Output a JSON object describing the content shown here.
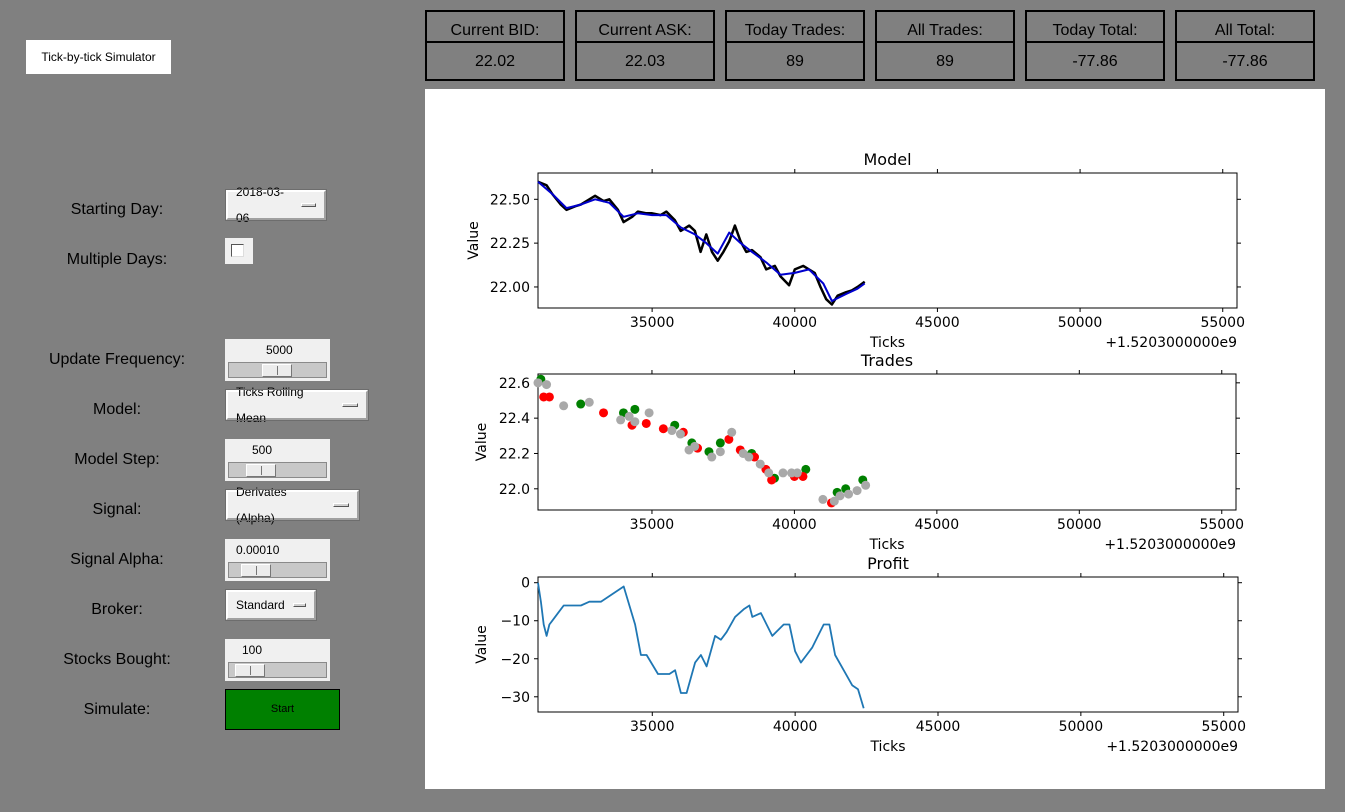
{
  "app": {
    "title": "Tick-by-tick Simulator"
  },
  "stats": [
    {
      "label": "Current BID:",
      "value": "22.02"
    },
    {
      "label": "Current ASK:",
      "value": "22.03"
    },
    {
      "label": "Today Trades:",
      "value": "89"
    },
    {
      "label": "All Trades:",
      "value": "89"
    },
    {
      "label": "Today Total:",
      "value": "-77.86"
    },
    {
      "label": "All Total:",
      "value": "-77.86"
    }
  ],
  "controls": {
    "starting_day": {
      "label": "Starting Day:",
      "value": "2018-03-06"
    },
    "multiple_days": {
      "label": "Multiple Days:",
      "checked": false
    },
    "update_frequency": {
      "label": "Update Frequency:",
      "value": "5000",
      "level": 0.42
    },
    "model": {
      "label": "Model:",
      "value": "Ticks Rolling Mean"
    },
    "model_step": {
      "label": "Model Step:",
      "value": "500",
      "level": 0.25
    },
    "signal": {
      "label": "Signal:",
      "value": "Derivates (Alpha)"
    },
    "signal_alpha": {
      "label": "Signal Alpha:",
      "value": "0.00010",
      "level": 0.2
    },
    "broker": {
      "label": "Broker:",
      "value": "Standard"
    },
    "stocks_bought": {
      "label": "Stocks Bought:",
      "value": "100",
      "level": 0.17
    },
    "simulate": {
      "label": "Simulate:",
      "button": "Start"
    }
  },
  "colors": {
    "background": "#808080",
    "start_button": "#008000",
    "price_line": "#000000",
    "model_line": "#0000cd",
    "buy": "#008000",
    "sell": "#ff0000",
    "neutral": "#a9a9a9",
    "profit_line": "#1f77b4"
  },
  "chart_data": [
    {
      "type": "line",
      "title": "Model",
      "xlabel": "Ticks",
      "ylabel": "Value",
      "offset_label": "+1.5203000000e9",
      "xlim": [
        31000,
        55500
      ],
      "ylim": [
        21.88,
        22.65
      ],
      "xticks": [
        35000,
        40000,
        45000,
        50000,
        55000
      ],
      "xtick_labels": [
        "35000",
        "40000",
        "45000",
        "50000",
        "55000"
      ],
      "yticks": [
        22.0,
        22.25,
        22.5
      ],
      "ytick_labels": [
        "22.00",
        "22.25",
        "22.50"
      ],
      "series": [
        {
          "role": "price",
          "x": [
            31000,
            31300,
            31500,
            31800,
            32000,
            32300,
            32500,
            32800,
            33000,
            33300,
            33500,
            33800,
            34000,
            34300,
            34500,
            34800,
            35000,
            35300,
            35500,
            35800,
            36000,
            36300,
            36500,
            36700,
            36900,
            37100,
            37300,
            37500,
            37700,
            37900,
            38100,
            38300,
            38500,
            38800,
            39000,
            39300,
            39500,
            39800,
            40000,
            40300,
            40500,
            40700,
            40900,
            41100,
            41300,
            41500,
            41800,
            42000,
            42200,
            42450
          ],
          "values": [
            22.6,
            22.58,
            22.53,
            22.47,
            22.44,
            22.46,
            22.47,
            22.5,
            22.52,
            22.49,
            22.5,
            22.44,
            22.37,
            22.4,
            22.43,
            22.42,
            22.42,
            22.41,
            22.43,
            22.38,
            22.32,
            22.35,
            22.32,
            22.2,
            22.3,
            22.2,
            22.15,
            22.2,
            22.26,
            22.35,
            22.26,
            22.2,
            22.21,
            22.17,
            22.1,
            22.12,
            22.06,
            22.01,
            22.1,
            22.12,
            22.1,
            22.08,
            22.0,
            21.93,
            21.9,
            21.95,
            21.97,
            21.98,
            22.0,
            22.03
          ]
        },
        {
          "role": "model",
          "x": [
            31000,
            31500,
            32000,
            32500,
            33000,
            33500,
            34000,
            34500,
            35000,
            35500,
            36000,
            36500,
            36900,
            37300,
            37700,
            38100,
            38500,
            39000,
            39500,
            40000,
            40500,
            41000,
            41300,
            41800,
            42200,
            42450
          ],
          "values": [
            22.6,
            22.53,
            22.45,
            22.47,
            22.5,
            22.48,
            22.4,
            22.42,
            22.41,
            22.41,
            22.34,
            22.3,
            22.25,
            22.19,
            22.31,
            22.25,
            22.2,
            22.14,
            22.07,
            22.08,
            22.1,
            22.02,
            21.92,
            21.96,
            21.99,
            22.02
          ]
        }
      ]
    },
    {
      "type": "scatter",
      "title": "Trades",
      "xlabel": "Ticks",
      "ylabel": "Value",
      "offset_label": "+1.5203000000e9",
      "xlim": [
        31000,
        55500
      ],
      "ylim": [
        21.88,
        22.65
      ],
      "xticks": [
        35000,
        40000,
        45000,
        50000,
        55000
      ],
      "xtick_labels": [
        "35000",
        "40000",
        "45000",
        "50000",
        "55000"
      ],
      "yticks": [
        22.0,
        22.2,
        22.4,
        22.6
      ],
      "ytick_labels": [
        "22.0",
        "22.2",
        "22.4",
        "22.6"
      ],
      "series": [
        {
          "name": "buy",
          "x": [
            31100,
            32500,
            34000,
            34400,
            35800,
            36400,
            37000,
            37400,
            38500,
            39300,
            40400,
            41500,
            41800,
            42400
          ],
          "values": [
            22.62,
            22.48,
            22.43,
            22.45,
            22.36,
            22.26,
            22.21,
            22.26,
            22.2,
            22.06,
            22.11,
            21.98,
            22.0,
            22.05
          ]
        },
        {
          "name": "sell",
          "x": [
            31200,
            31400,
            33300,
            34300,
            34800,
            35400,
            36100,
            36600,
            37700,
            38100,
            38600,
            39000,
            39200,
            40000,
            40300,
            41300
          ],
          "values": [
            22.52,
            22.52,
            22.43,
            22.36,
            22.37,
            22.34,
            22.32,
            22.23,
            22.28,
            22.22,
            22.18,
            22.11,
            22.05,
            22.07,
            22.07,
            21.92
          ]
        },
        {
          "name": "neutral",
          "x": [
            31000,
            31300,
            31900,
            32800,
            33900,
            34200,
            34400,
            34900,
            35700,
            36000,
            36300,
            36500,
            37100,
            37400,
            37800,
            38200,
            38400,
            38800,
            39100,
            39600,
            39900,
            40100,
            41000,
            41400,
            41600,
            41900,
            42200,
            42500
          ],
          "values": [
            22.6,
            22.59,
            22.47,
            22.49,
            22.39,
            22.41,
            22.38,
            22.43,
            22.33,
            22.31,
            22.22,
            22.24,
            22.18,
            22.21,
            22.32,
            22.2,
            22.18,
            22.14,
            22.09,
            22.09,
            22.09,
            22.09,
            21.94,
            21.93,
            21.96,
            21.97,
            21.99,
            22.02
          ]
        }
      ]
    },
    {
      "type": "line",
      "title": "Profit",
      "xlabel": "Ticks",
      "ylabel": "Value",
      "offset_label": "+1.5203000000e9",
      "xlim": [
        31000,
        55500
      ],
      "ylim": [
        -34,
        1.5
      ],
      "xticks": [
        35000,
        40000,
        45000,
        50000,
        55000
      ],
      "xtick_labels": [
        "35000",
        "40000",
        "45000",
        "50000",
        "55000"
      ],
      "yticks": [
        0,
        -10,
        -20,
        -30
      ],
      "ytick_labels": [
        "0",
        "−10",
        "−20",
        "−30"
      ],
      "series": [
        {
          "role": "profit",
          "x": [
            31000,
            31100,
            31200,
            31300,
            31400,
            31500,
            31700,
            31900,
            32100,
            32500,
            32800,
            33200,
            33600,
            34000,
            34200,
            34400,
            34600,
            34800,
            35200,
            35600,
            35800,
            36000,
            36200,
            36500,
            36700,
            36900,
            37200,
            37400,
            37600,
            37900,
            38200,
            38400,
            38500,
            38800,
            39000,
            39200,
            39600,
            39800,
            40000,
            40200,
            40400,
            40600,
            40800,
            41000,
            41200,
            41400,
            41700,
            42000,
            42200,
            42400
          ],
          "values": [
            0,
            -5,
            -11,
            -14,
            -11,
            -10,
            -8,
            -6,
            -6,
            -6,
            -5,
            -5,
            -3,
            -1,
            -6,
            -11,
            -19,
            -19,
            -24,
            -24,
            -23,
            -29,
            -29,
            -21,
            -19,
            -22,
            -14,
            -15,
            -13,
            -9,
            -7,
            -6,
            -9,
            -8,
            -11,
            -14,
            -11,
            -11,
            -18,
            -21,
            -19,
            -17,
            -14,
            -11,
            -11,
            -19,
            -23,
            -27,
            -28,
            -33
          ]
        }
      ]
    }
  ]
}
